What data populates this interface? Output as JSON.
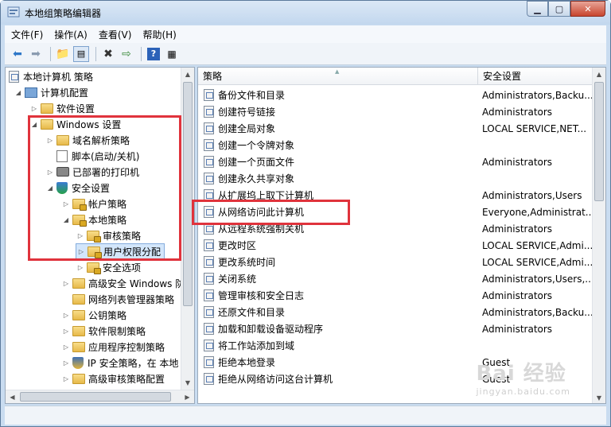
{
  "window": {
    "title": "本地组策略编辑器"
  },
  "menu": [
    {
      "label": "文件(F)"
    },
    {
      "label": "操作(A)"
    },
    {
      "label": "查看(V)"
    },
    {
      "label": "帮助(H)"
    }
  ],
  "toolbar": {
    "icons": [
      "back-arrow-icon",
      "forward-arrow-icon",
      "up-folder-icon",
      "show-tree-icon",
      "delete-icon",
      "export-icon",
      "help-icon",
      "properties-icon"
    ]
  },
  "tree": {
    "root": "本地计算机 策略",
    "items": [
      {
        "label": "计算机配置"
      },
      {
        "label": "软件设置"
      },
      {
        "label": "Windows 设置"
      },
      {
        "label": "域名解析策略"
      },
      {
        "label": "脚本(启动/关机)"
      },
      {
        "label": "已部署的打印机"
      },
      {
        "label": "安全设置"
      },
      {
        "label": "帐户策略"
      },
      {
        "label": "本地策略"
      },
      {
        "label": "审核策略"
      },
      {
        "label": "用户权限分配"
      },
      {
        "label": "安全选项"
      },
      {
        "label": "高级安全 Windows 防"
      },
      {
        "label": "网络列表管理器策略"
      },
      {
        "label": "公钥策略"
      },
      {
        "label": "软件限制策略"
      },
      {
        "label": "应用程序控制策略"
      },
      {
        "label": "IP 安全策略，在 本地"
      },
      {
        "label": "高级审核策略配置"
      }
    ]
  },
  "list": {
    "columns": {
      "policy": "策略",
      "setting": "安全设置"
    },
    "rows": [
      {
        "policy": "备份文件和目录",
        "setting": "Administrators,Backu..."
      },
      {
        "policy": "创建符号链接",
        "setting": "Administrators"
      },
      {
        "policy": "创建全局对象",
        "setting": "LOCAL SERVICE,NET..."
      },
      {
        "policy": "创建一个令牌对象",
        "setting": ""
      },
      {
        "policy": "创建一个页面文件",
        "setting": "Administrators"
      },
      {
        "policy": "创建永久共享对象",
        "setting": ""
      },
      {
        "policy": "从扩展坞上取下计算机",
        "setting": "Administrators,Users"
      },
      {
        "policy": "从网络访问此计算机",
        "setting": "Everyone,Administrat..."
      },
      {
        "policy": "从远程系统强制关机",
        "setting": "Administrators"
      },
      {
        "policy": "更改时区",
        "setting": "LOCAL SERVICE,Admi..."
      },
      {
        "policy": "更改系统时间",
        "setting": "LOCAL SERVICE,Admi..."
      },
      {
        "policy": "关闭系统",
        "setting": "Administrators,Users,..."
      },
      {
        "policy": "管理审核和安全日志",
        "setting": "Administrators"
      },
      {
        "policy": "还原文件和目录",
        "setting": "Administrators,Backu..."
      },
      {
        "policy": "加载和卸载设备驱动程序",
        "setting": "Administrators"
      },
      {
        "policy": "将工作站添加到域",
        "setting": ""
      },
      {
        "policy": "拒绝本地登录",
        "setting": "Guest"
      },
      {
        "policy": "拒绝从网络访问这台计算机",
        "setting": "Guest"
      }
    ]
  },
  "watermark": {
    "main": "Bai 经验",
    "sub": "jingyan.baidu.com"
  },
  "colors": {
    "highlight": "#e0333c",
    "selection": "#d3e6fb"
  }
}
